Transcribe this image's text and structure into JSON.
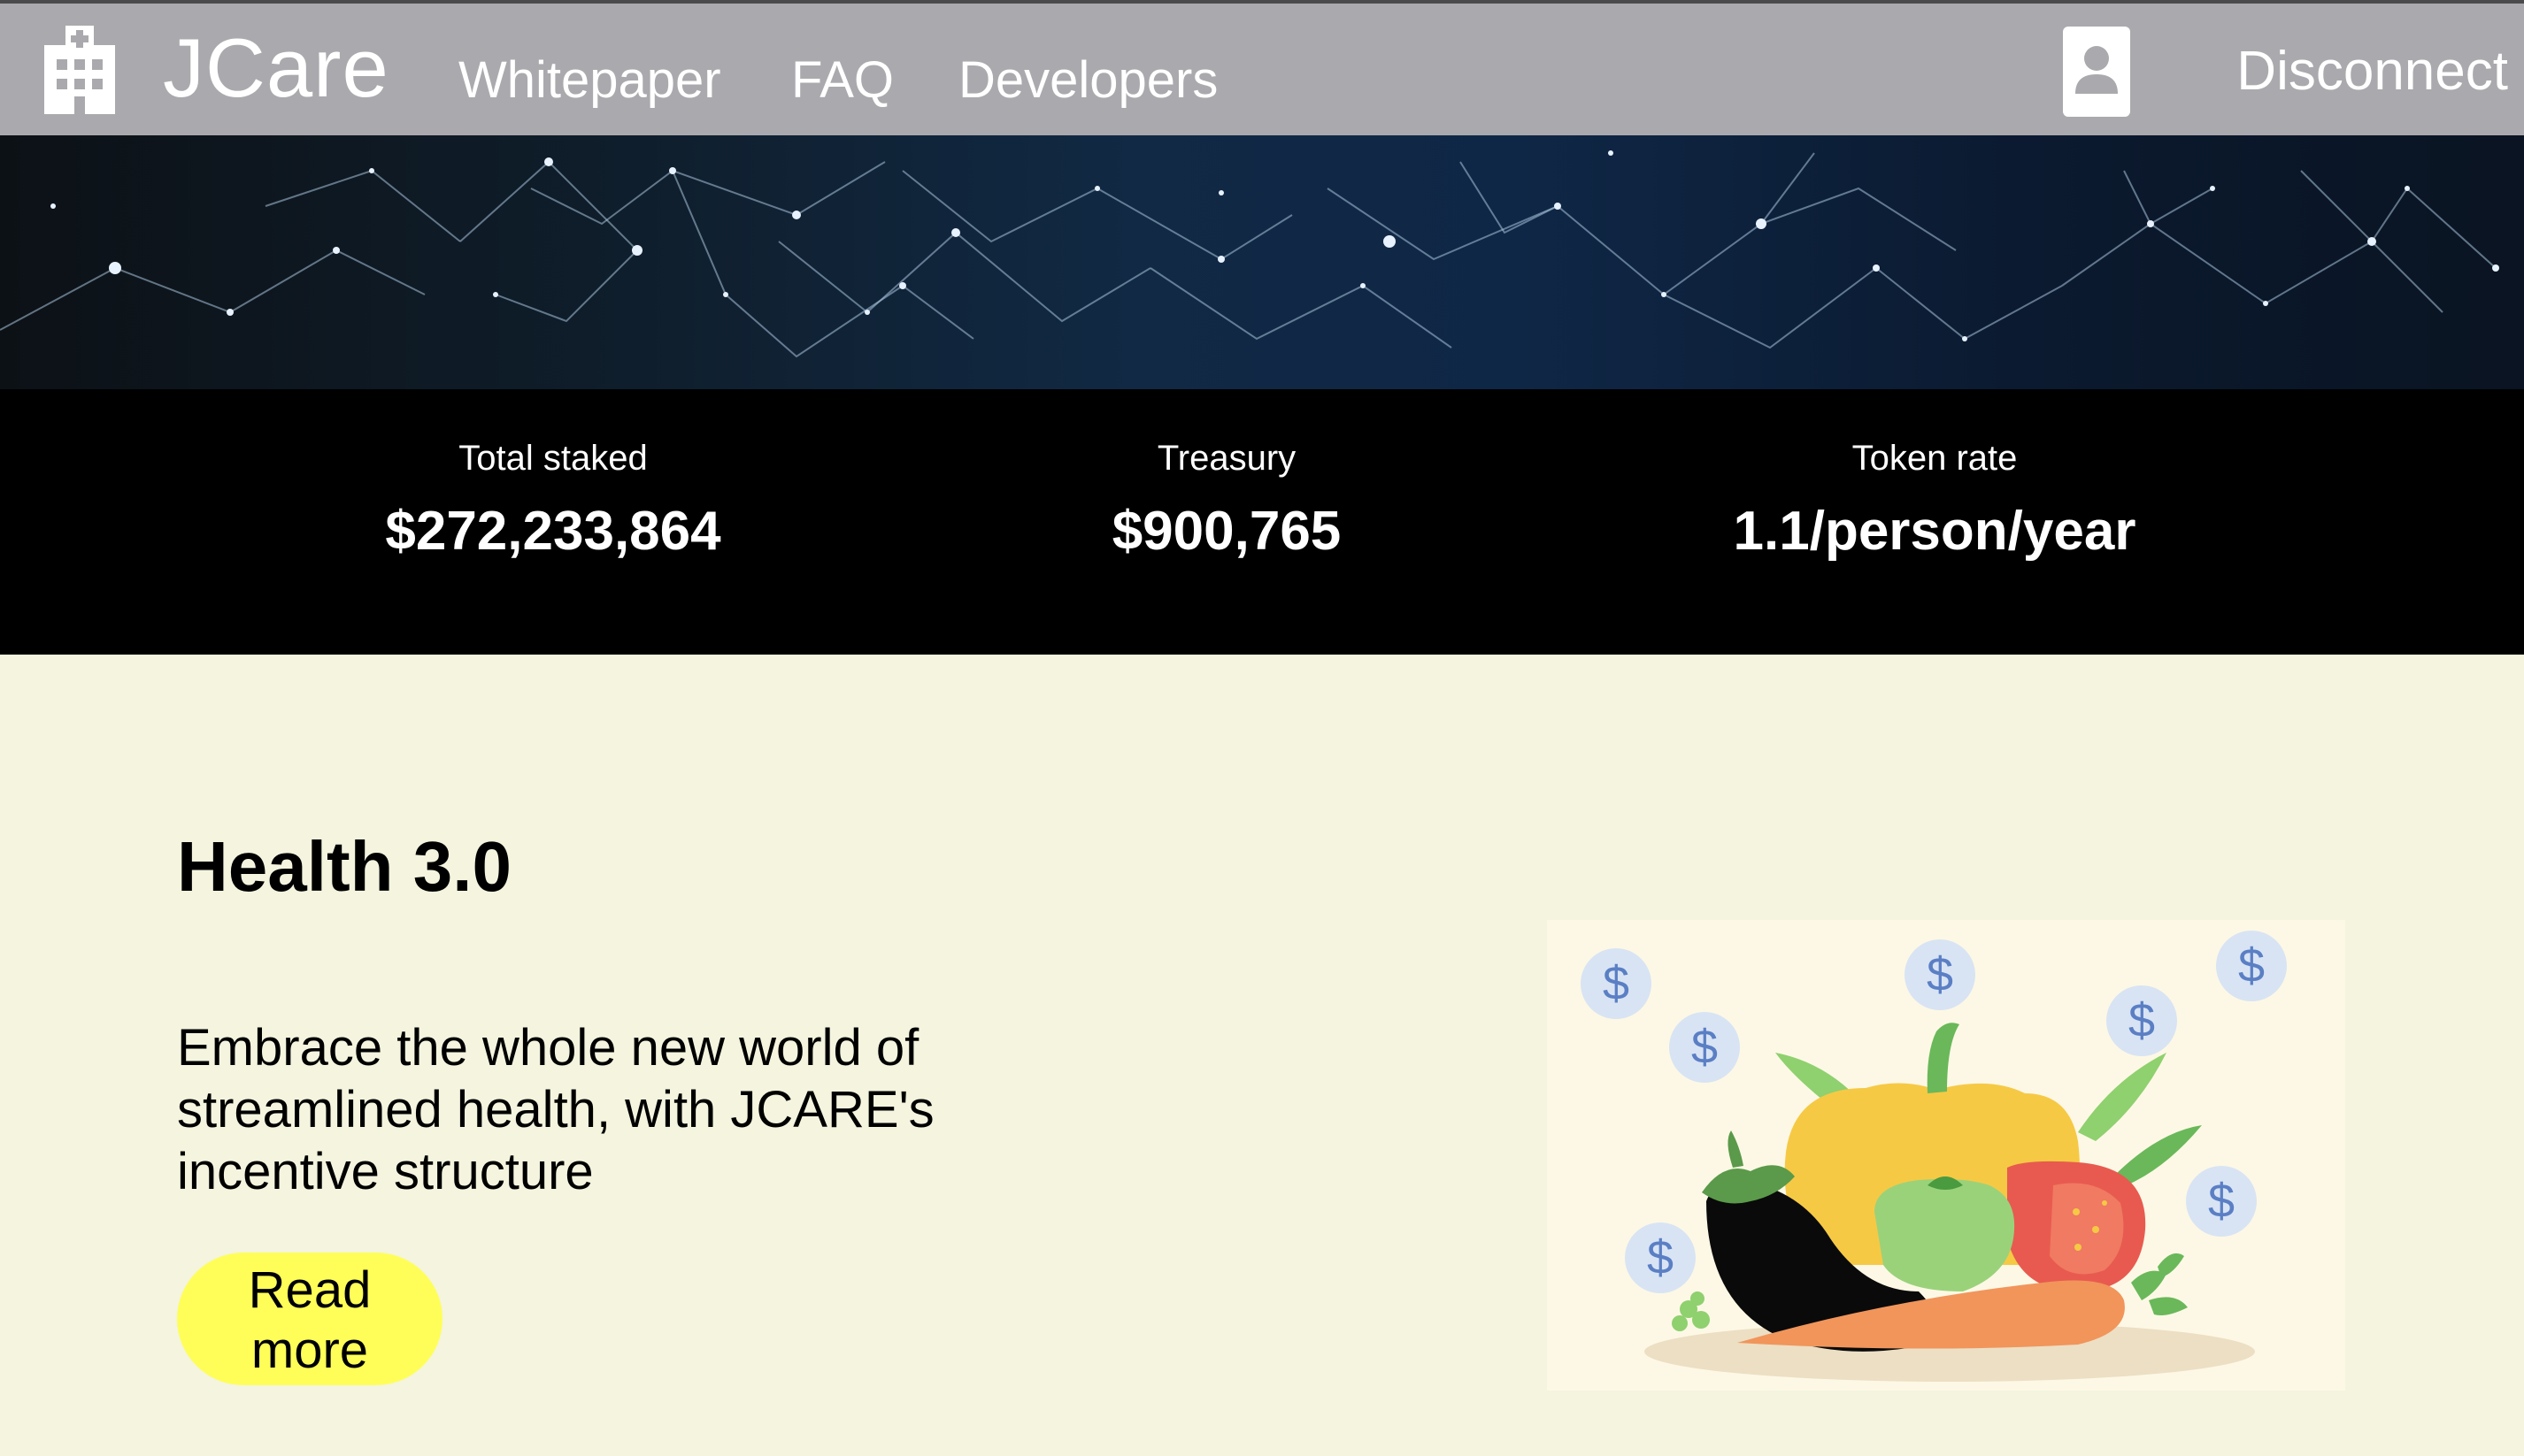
{
  "navbar": {
    "brand_icon": "hospital-icon",
    "brand_name": "JCare",
    "links": [
      "Whitepaper",
      "FAQ",
      "Developers"
    ],
    "account_icon": "user-badge-icon",
    "account_action": "Disconnect"
  },
  "stats": [
    {
      "label": "Total staked",
      "value": "$272,233,864"
    },
    {
      "label": "Treasury",
      "value": "$900,765"
    },
    {
      "label": "Token rate",
      "value": "1.1/person/year"
    }
  ],
  "feature": {
    "title": "Health 3.0",
    "description": "Embrace the whole new world of streamlined health, with JCARE's incentive structure",
    "button_label": "Read more",
    "button_color": "#fffe58",
    "illustration_coin_symbol": "$"
  },
  "colors": {
    "navbar_bg": "#aaa9ad",
    "stats_bg": "#000000",
    "page_bg": "#f4f4df"
  }
}
